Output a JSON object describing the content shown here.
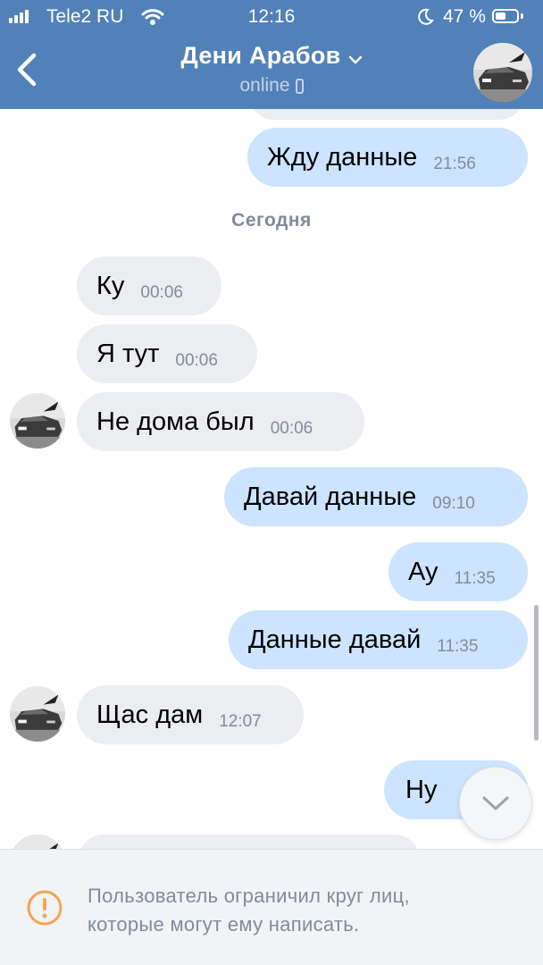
{
  "status_bar": {
    "carrier": "Tele2 RU",
    "time": "12:16",
    "battery_percent": "47 %",
    "battery_level": 0.47
  },
  "header": {
    "title": "Дени Арабов",
    "status": "online"
  },
  "chat": {
    "date_separator": "Сегодня",
    "messages": [
      {
        "dir": "out",
        "text": "Жду данные",
        "time": "21:56"
      },
      {
        "dir": "in",
        "text": "Ку",
        "time": "00:06"
      },
      {
        "dir": "in",
        "text": "Я тут",
        "time": "00:06"
      },
      {
        "dir": "in",
        "text": "Не дома был",
        "time": "00:06"
      },
      {
        "dir": "out",
        "text": "Давай данные",
        "time": "09:10"
      },
      {
        "dir": "out",
        "text": "Ау",
        "time": "11:35"
      },
      {
        "dir": "out",
        "text": "Данные давай",
        "time": "11:35"
      },
      {
        "dir": "in",
        "text": "Щас дам",
        "time": "12:07"
      },
      {
        "dir": "out",
        "text": "Ну",
        "time": ""
      }
    ]
  },
  "notice": {
    "line1": "Пользователь ограничил круг лиц,",
    "line2": "которые могут ему написать."
  },
  "colors": {
    "header": "#5181b8",
    "incoming_bubble": "#ebedf0",
    "outgoing_bubble": "#cce4ff",
    "warning": "#f0a454"
  },
  "icons": {
    "back": "chevron-left-icon",
    "title_dropdown": "chevron-down-icon",
    "device": "phone-icon",
    "scroll_down": "chevron-down-icon",
    "warning": "exclamation-circle-icon"
  }
}
